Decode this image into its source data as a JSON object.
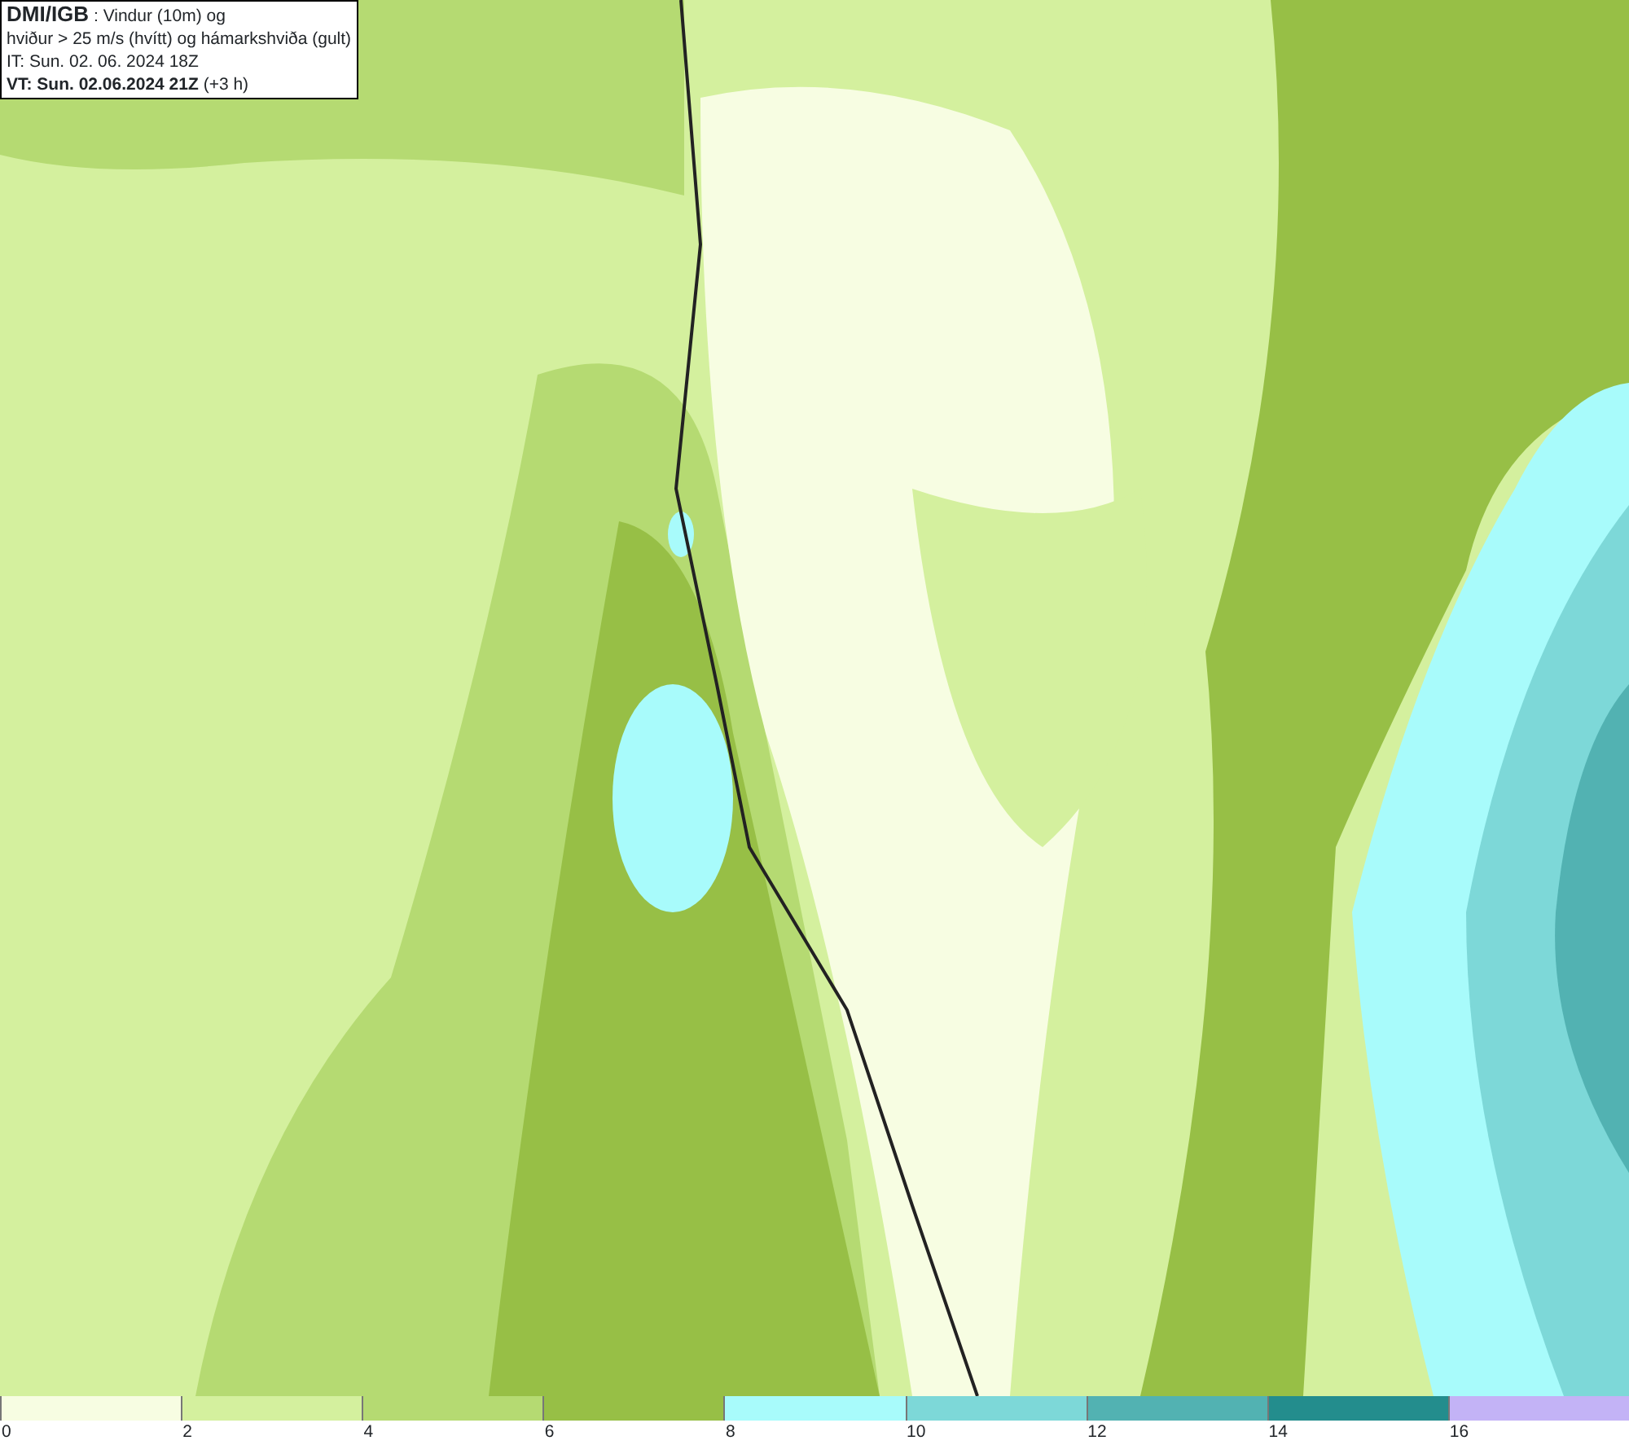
{
  "info_box": {
    "lines": [
      "**DMI/IGB** : Vindur (10m) og",
      "hviður > 25 m/s (hvítt) og hámarkshviða (gult)",
      "IT: Sun. 02. 06. 2024 18Z",
      "**VT: Sun. 02.06.2024 21Z** (+3 h)"
    ]
  },
  "legend": {
    "bins": [
      {
        "label": "0",
        "color": "#f7fde2"
      },
      {
        "label": "2",
        "color": "#d4f09e"
      },
      {
        "label": "4",
        "color": "#b5da72"
      },
      {
        "label": "6",
        "color": "#97bf46"
      },
      {
        "label": "8",
        "color": "#a8fbfb"
      },
      {
        "label": "10",
        "color": "#7dd8d8"
      },
      {
        "label": "12",
        "color": "#52b2b2"
      },
      {
        "label": "14",
        "color": "#238d8d"
      },
      {
        "label": "16",
        "color": "#c3b3f6"
      }
    ]
  }
}
